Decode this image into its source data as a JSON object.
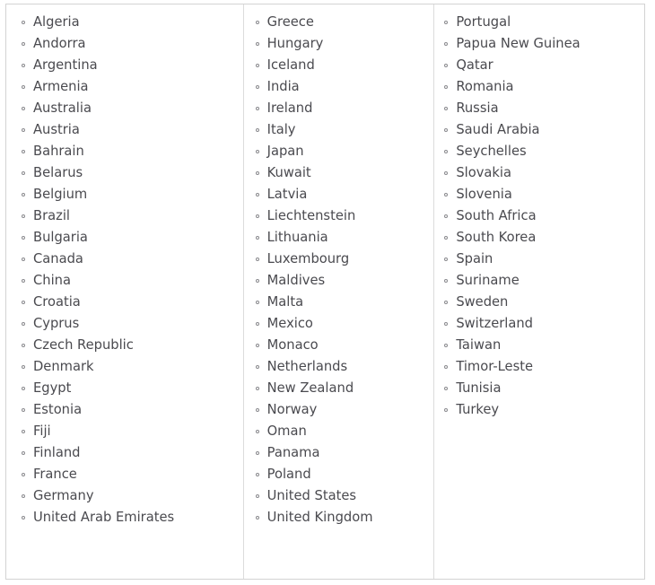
{
  "panel": {
    "name": "country-list-panel",
    "bullet_icon": "circle-outline-icon",
    "border_color": "#d3d3d3",
    "divider_color": "#dcdcdc",
    "text_color": "#4a4a4f",
    "background_color": "#ffffff"
  },
  "columns": [
    {
      "id": "column-1",
      "items": [
        "Algeria",
        "Andorra",
        "Argentina",
        "Armenia",
        "Australia",
        "Austria",
        "Bahrain",
        "Belarus",
        "Belgium",
        "Brazil",
        "Bulgaria",
        "Canada",
        "China",
        "Croatia",
        "Cyprus",
        "Czech Republic",
        "Denmark",
        "Egypt",
        "Estonia",
        "Fiji",
        "Finland",
        "France",
        "Germany",
        "United Arab Emirates"
      ]
    },
    {
      "id": "column-2",
      "items": [
        "Greece",
        "Hungary",
        "Iceland",
        "India",
        "Ireland",
        "Italy",
        "Japan",
        "Kuwait",
        "Latvia",
        "Liechtenstein",
        "Lithuania",
        "Luxembourg",
        "Maldives",
        "Malta",
        "Mexico",
        "Monaco",
        "Netherlands",
        "New Zealand",
        "Norway",
        "Oman",
        "Panama",
        "Poland",
        "United States",
        "United Kingdom"
      ]
    },
    {
      "id": "column-3",
      "items": [
        "Portugal",
        "Papua New Guinea",
        "Qatar",
        "Romania",
        "Russia",
        "Saudi Arabia",
        "Seychelles",
        "Slovakia",
        "Slovenia",
        "South Africa",
        "South Korea",
        "Spain",
        "Suriname",
        "Sweden",
        "Switzerland",
        "Taiwan",
        "Timor-Leste",
        "Tunisia",
        "Turkey"
      ]
    }
  ]
}
